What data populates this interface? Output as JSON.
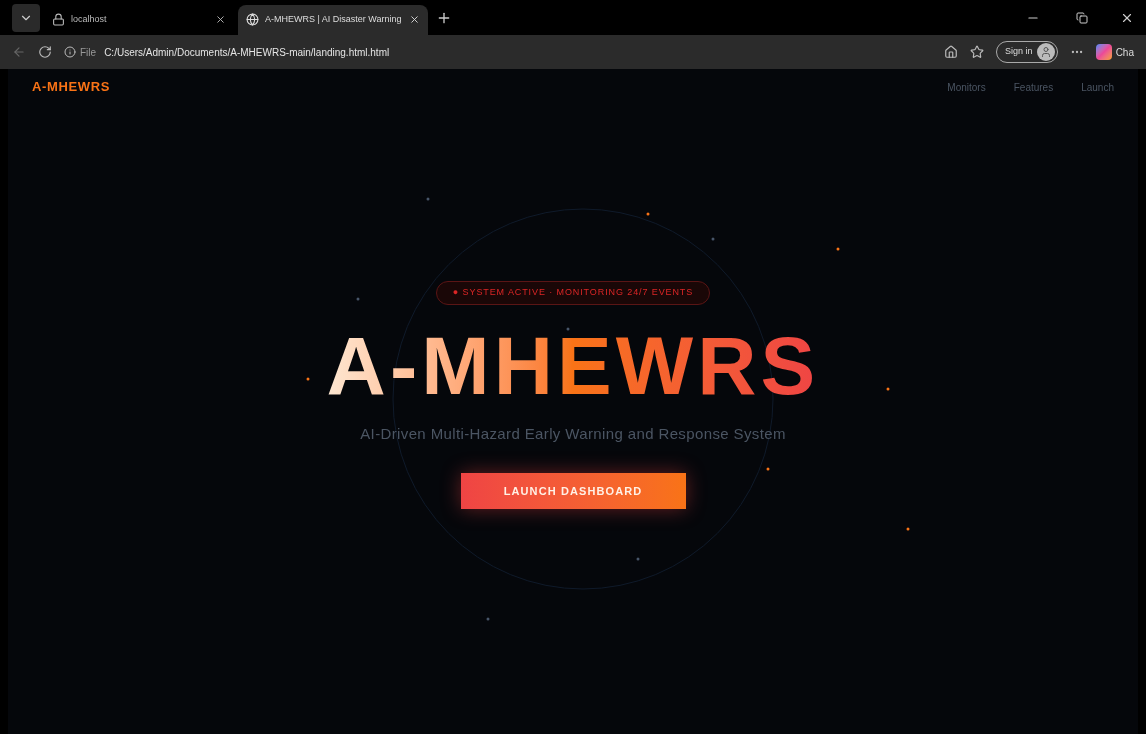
{
  "browser": {
    "tabs": [
      {
        "title": "localhost",
        "selected": false
      },
      {
        "title": "A-MHEWRS | AI Disaster Warning",
        "selected": true
      }
    ],
    "address": {
      "scheme": "File",
      "url": "C:/Users/Admin/Documents/A-MHEWRS-main/landing.html.html"
    },
    "sign_in": "Sign in",
    "copilot": "Cha"
  },
  "nav": {
    "logo": "A-MHEWRS",
    "links": [
      "Monitors",
      "Features",
      "Launch"
    ]
  },
  "hero": {
    "badge": "● SYSTEM ACTIVE · MONITORING 24/7 EVENTS",
    "title": "A-MHEWRS",
    "subtitle": "AI-Driven Multi-Hazard Early Warning and Response System",
    "button": "LAUNCH DASHBOARD"
  }
}
